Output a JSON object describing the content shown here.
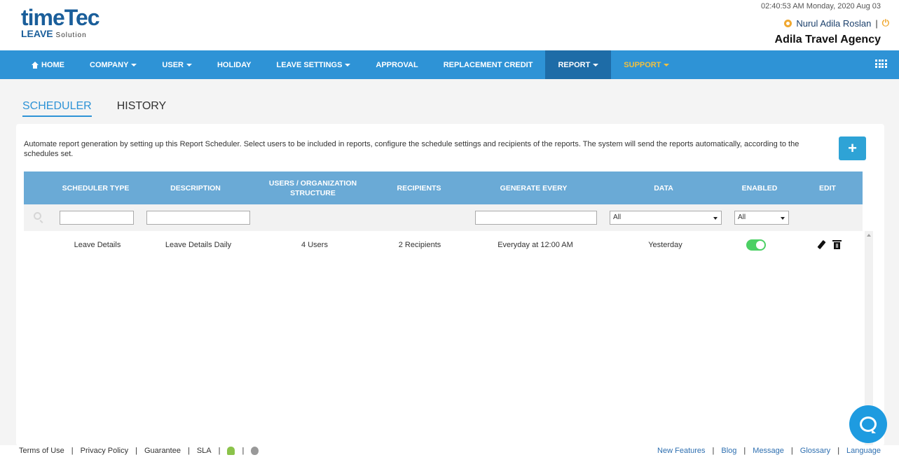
{
  "header": {
    "logo_top": "timeTec",
    "logo_bottom": "LEAVE",
    "logo_sub": "Solution",
    "datetime": "02:40:53 AM Monday, 2020 Aug 03",
    "user_name": "Nurul Adila Roslan",
    "separator": "|",
    "company": "Adila Travel Agency"
  },
  "nav": {
    "items": [
      {
        "label": "HOME"
      },
      {
        "label": "COMPANY"
      },
      {
        "label": "USER"
      },
      {
        "label": "HOLIDAY"
      },
      {
        "label": "LEAVE SETTINGS"
      },
      {
        "label": "APPROVAL"
      },
      {
        "label": "REPLACEMENT CREDIT"
      },
      {
        "label": "REPORT"
      },
      {
        "label": "SUPPORT"
      }
    ],
    "active": "REPORT"
  },
  "tabs": [
    {
      "label": "SCHEDULER"
    },
    {
      "label": "HISTORY"
    }
  ],
  "main": {
    "description": "Automate report generation by setting up this Report Scheduler. Select users to be included in reports, configure the schedule settings and recipients of the reports. The system will send the reports automatically, according to the schedules set.",
    "add_label": "+",
    "columns": [
      {
        "label": "SCHEDULER TYPE"
      },
      {
        "label": "DESCRIPTION"
      },
      {
        "label": "USERS / ORGANIZATION STRUCTURE"
      },
      {
        "label": "RECIPIENTS"
      },
      {
        "label": "GENERATE EVERY"
      },
      {
        "label": "DATA"
      },
      {
        "label": "ENABLED"
      },
      {
        "label": "EDIT"
      }
    ],
    "filters": {
      "data_select": "All",
      "enabled_select": "All"
    },
    "rows": [
      {
        "scheduler_type": "Leave Details",
        "description": "Leave Details Daily",
        "users": "4 Users",
        "recipients": "2 Recipients",
        "generate_every": "Everyday at 12:00 AM",
        "data": "Yesterday",
        "enabled": true
      }
    ]
  },
  "footer": {
    "left": [
      {
        "label": "Terms of Use"
      },
      {
        "label": "Privacy Policy"
      },
      {
        "label": "Guarantee"
      },
      {
        "label": "SLA"
      }
    ],
    "right": [
      {
        "label": "New Features"
      },
      {
        "label": "Blog"
      },
      {
        "label": "Message"
      },
      {
        "label": "Glossary"
      },
      {
        "label": "Language"
      }
    ],
    "separator": "|"
  },
  "colors": {
    "nav_bg": "#2e93d6",
    "nav_active": "#1e6ca7",
    "support": "#f0c040",
    "table_header": "#6aaad6",
    "toggle_on": "#4cd064",
    "brand": "#1a5e9a"
  }
}
